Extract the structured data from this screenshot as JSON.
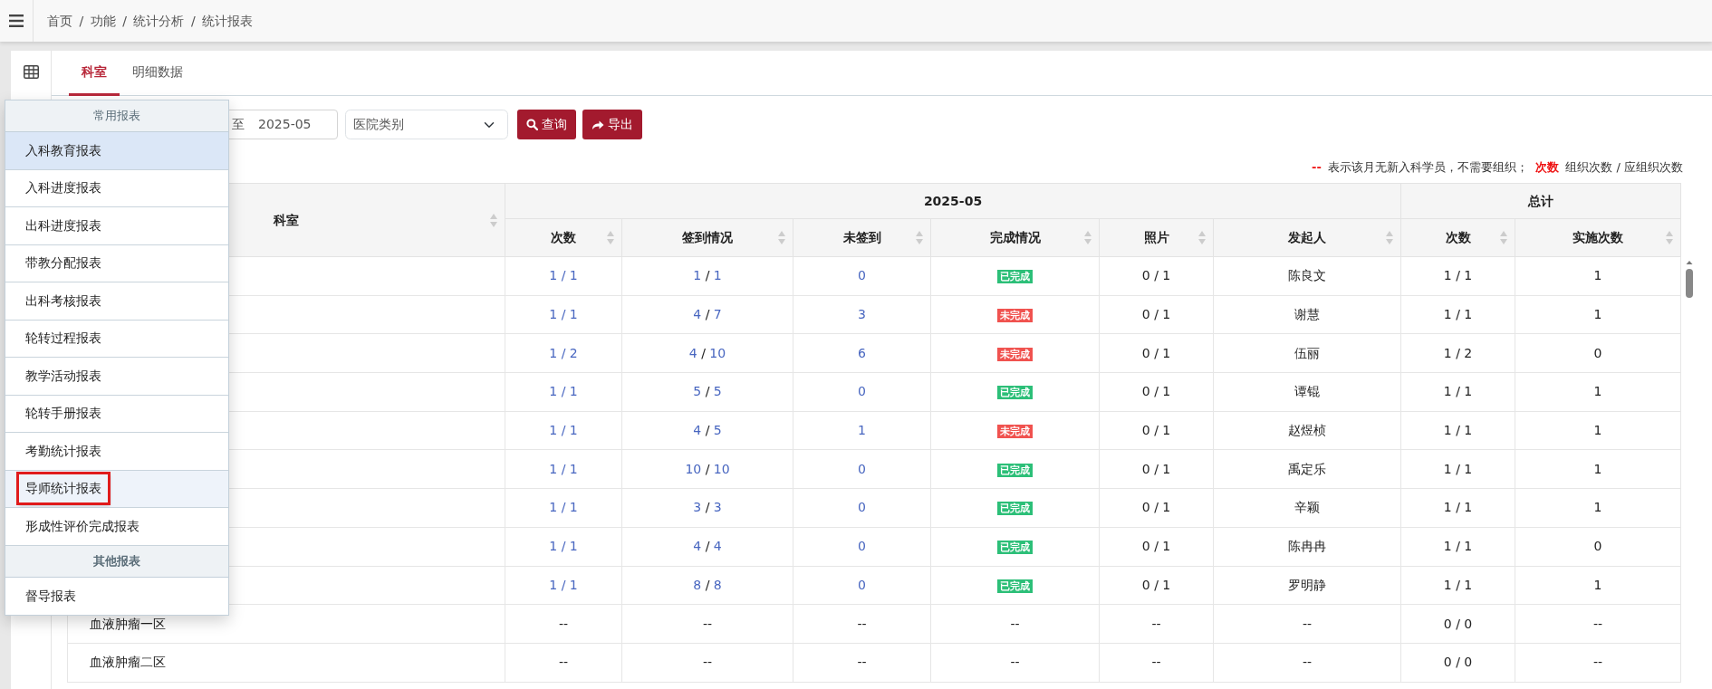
{
  "breadcrumb": {
    "separator": "/",
    "items": [
      "首页",
      "功能",
      "统计分析",
      "统计报表"
    ]
  },
  "tabs": [
    {
      "label": "科室",
      "selected": true
    },
    {
      "label": "明细数据",
      "selected": false
    }
  ],
  "filters": {
    "date_range": {
      "separator": "至",
      "value": "2025-05"
    },
    "hospital_type": {
      "placeholder": "医院类别"
    },
    "buttons": [
      {
        "label": "查询",
        "kind": "search"
      },
      {
        "label": "导出",
        "kind": "export"
      }
    ]
  },
  "legend": [
    {
      "text": "--",
      "kind": "mark"
    },
    {
      "text": "表示该月无新入科学员，不需要组织；",
      "kind": "text"
    },
    {
      "text": "次数",
      "kind": "mark"
    },
    {
      "text": "组织次数 / 应组织次数",
      "kind": "text"
    }
  ],
  "table": {
    "dept_column": "科室",
    "groups": [
      {
        "label": "2025-05",
        "columns": [
          "次数",
          "签到情况",
          "未签到",
          "完成情况",
          "照片",
          "发起人"
        ]
      },
      {
        "label": "总计",
        "columns": [
          "次数",
          "实施次数"
        ]
      }
    ],
    "rows": [
      {
        "kind": "active",
        "count": "1 / 1",
        "signin": "1 / 1",
        "unsigned": "0",
        "status": {
          "label": "已完成",
          "kind": "done"
        },
        "photos": "0 / 1",
        "initiator": "陈良文",
        "total_count": "1 / 1",
        "done_count": "1"
      },
      {
        "kind": "active",
        "count": "1 / 1",
        "signin": "4 / 7",
        "unsigned": "3",
        "status": {
          "label": "未完成",
          "kind": "pending"
        },
        "photos": "0 / 1",
        "initiator": "谢慧",
        "total_count": "1 / 1",
        "done_count": "1"
      },
      {
        "kind": "active",
        "count": "1 / 2",
        "signin": "4 / 10",
        "unsigned": "6",
        "status": {
          "label": "未完成",
          "kind": "pending"
        },
        "photos": "0 / 1",
        "initiator": "伍丽",
        "total_count": "1 / 2",
        "done_count": "0"
      },
      {
        "kind": "active",
        "count": "1 / 1",
        "signin": "5 / 5",
        "unsigned": "0",
        "status": {
          "label": "已完成",
          "kind": "done"
        },
        "photos": "0 / 1",
        "initiator": "谭锟",
        "total_count": "1 / 1",
        "done_count": "1"
      },
      {
        "kind": "active",
        "count": "1 / 1",
        "signin": "4 / 5",
        "unsigned": "1",
        "status": {
          "label": "未完成",
          "kind": "pending"
        },
        "photos": "0 / 1",
        "initiator": "赵煜桢",
        "total_count": "1 / 1",
        "done_count": "1"
      },
      {
        "kind": "active",
        "count": "1 / 1",
        "signin": "10 / 10",
        "unsigned": "0",
        "status": {
          "label": "已完成",
          "kind": "done"
        },
        "photos": "0 / 1",
        "initiator": "禹定乐",
        "total_count": "1 / 1",
        "done_count": "1"
      },
      {
        "kind": "active",
        "count": "1 / 1",
        "signin": "3 / 3",
        "unsigned": "0",
        "status": {
          "label": "已完成",
          "kind": "done"
        },
        "photos": "0 / 1",
        "initiator": "辛颖",
        "total_count": "1 / 1",
        "done_count": "1"
      },
      {
        "kind": "active",
        "count": "1 / 1",
        "signin": "4 / 4",
        "unsigned": "0",
        "status": {
          "label": "已完成",
          "kind": "done"
        },
        "photos": "0 / 1",
        "initiator": "陈冉冉",
        "total_count": "1 / 1",
        "done_count": "0"
      },
      {
        "kind": "active",
        "count": "1 / 1",
        "signin": "8 / 8",
        "unsigned": "0",
        "status": {
          "label": "已完成",
          "kind": "done"
        },
        "photos": "0 / 1",
        "initiator": "罗明静",
        "total_count": "1 / 1",
        "done_count": "1"
      },
      {
        "kind": "empty",
        "dept": "血液肿瘤一区",
        "count": "--",
        "signin": "--",
        "unsigned": "--",
        "status": {
          "label": "--",
          "kind": "none"
        },
        "photos": "--",
        "initiator": "--",
        "total_count": "0 / 0",
        "done_count": "--"
      },
      {
        "kind": "empty",
        "dept": "血液肿瘤二区",
        "count": "--",
        "signin": "--",
        "unsigned": "--",
        "status": {
          "label": "--",
          "kind": "none"
        },
        "photos": "--",
        "initiator": "--",
        "total_count": "0 / 0",
        "done_count": "--"
      }
    ]
  },
  "report_menu": {
    "groups": [
      {
        "header": "常用报表",
        "items": [
          {
            "label": "入科教育报表",
            "selected": true,
            "outlined": false
          },
          {
            "label": "入科进度报表",
            "selected": false,
            "outlined": false
          },
          {
            "label": "出科进度报表",
            "selected": false,
            "outlined": false
          },
          {
            "label": "带教分配报表",
            "selected": false,
            "outlined": false
          },
          {
            "label": "出科考核报表",
            "selected": false,
            "outlined": false
          },
          {
            "label": "轮转过程报表",
            "selected": false,
            "outlined": false
          },
          {
            "label": "教学活动报表",
            "selected": false,
            "outlined": false
          },
          {
            "label": "轮转手册报表",
            "selected": false,
            "outlined": false
          },
          {
            "label": "考勤统计报表",
            "selected": false,
            "outlined": false
          },
          {
            "label": "导师统计报表",
            "selected": false,
            "outlined": true
          },
          {
            "label": "形成性评价完成报表",
            "selected": false,
            "outlined": false
          }
        ]
      },
      {
        "header": "其他报表",
        "items": [
          {
            "label": "督导报表",
            "selected": false,
            "outlined": false
          }
        ]
      }
    ]
  }
}
